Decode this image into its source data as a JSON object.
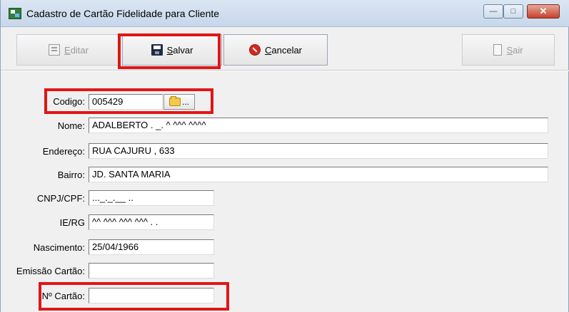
{
  "window": {
    "title": "Cadastro de Cartão Fidelidade para Cliente",
    "controls": {
      "minimize": "—",
      "maximize": "□",
      "close": "✕"
    }
  },
  "toolbar": {
    "editar": {
      "prefix": "",
      "underline": "E",
      "rest": "ditar",
      "icon": "edit-icon"
    },
    "salvar": {
      "underline": "S",
      "rest": "alvar",
      "icon": "save-icon"
    },
    "cancelar": {
      "underline": "C",
      "rest": "ancelar",
      "icon": "cancel-icon"
    },
    "sair": {
      "underline": "S",
      "rest": "air",
      "icon": "exit-icon"
    }
  },
  "form": {
    "codigo": {
      "label": "Codigo:",
      "value": "005429",
      "button_text": "..."
    },
    "nome": {
      "label": "Nome:",
      "value": "ADALBERTO  . _.    ^ ^^^ ^^^^"
    },
    "endereco": {
      "label": "Endereço:",
      "value": "RUA CAJURU , 633"
    },
    "bairro": {
      "label": "Bairro:",
      "value": "JD. SANTA MARIA"
    },
    "cnpj": {
      "label": "CNPJ/CPF:",
      "value": "..._._.__ .."
    },
    "ie": {
      "label": "IE/RG",
      "value": "^^ ^^^ ^^^ ^^^ .  ."
    },
    "nascimento": {
      "label": "Nascimento:",
      "value": "25/04/1966"
    },
    "emissao": {
      "label": "Emissão Cartão:",
      "value": ""
    },
    "num_cartao": {
      "label": "Nº Cartão:",
      "value": ""
    }
  },
  "highlight_color": "#e01616"
}
